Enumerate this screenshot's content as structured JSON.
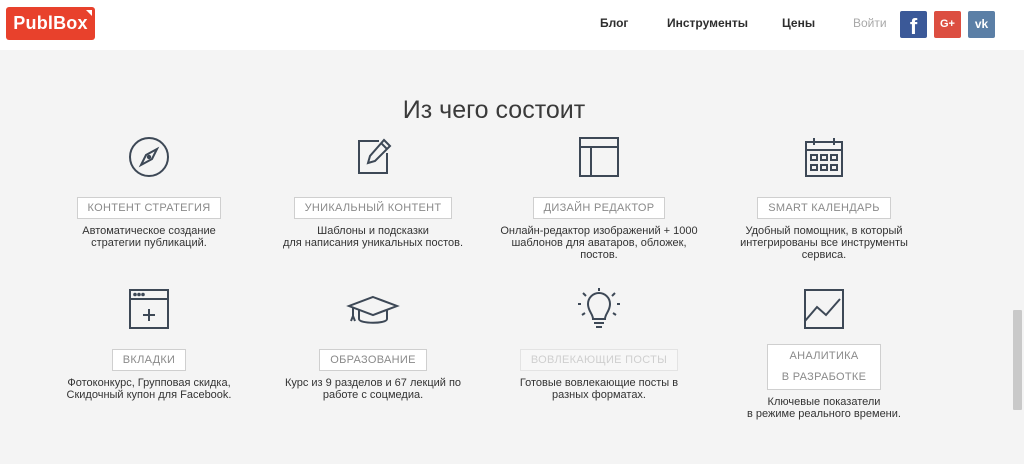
{
  "header": {
    "logo": "PublBox",
    "nav": [
      "Блог",
      "Инструменты",
      "Цены"
    ],
    "login": "Войти",
    "social": [
      {
        "name": "facebook",
        "label": "f",
        "color": "#3b5998"
      },
      {
        "name": "google-plus",
        "label": "G+",
        "color": "#dc4e41"
      },
      {
        "name": "vk",
        "label": "vk",
        "color": "#5b7fa6"
      }
    ]
  },
  "section": {
    "title": "Из чего состоит",
    "features": [
      {
        "icon": "compass-icon",
        "badge": "КОНТЕНТ СТРАТЕГИЯ",
        "desc": [
          "Автоматическое создание",
          "стратегии публикаций."
        ]
      },
      {
        "icon": "edit-icon",
        "badge": "УНИКАЛЬНЫЙ КОНТЕНТ",
        "desc": [
          "Шаблоны и подсказки",
          "для написания уникальных постов."
        ]
      },
      {
        "icon": "layout-icon",
        "badge": "ДИЗАЙН РЕДАКТОР",
        "desc": [
          "Онлайн-редактор изображений + 1000",
          "шаблонов для аватаров, обложек,",
          "постов."
        ]
      },
      {
        "icon": "calendar-icon",
        "badge": "SMART КАЛЕНДАРЬ",
        "desc": [
          "Удобный помощник, в который",
          "интегрированы все инструменты",
          "сервиса."
        ]
      },
      {
        "icon": "browser-add-icon",
        "badge": "ВКЛАДКИ",
        "desc": [
          "Фотоконкурс, Групповая скидка,",
          "Скидочный купон для Facebook."
        ]
      },
      {
        "icon": "graduation-cap-icon",
        "badge": "ОБРАЗОВАНИЕ",
        "desc": [
          "Курс из 9 разделов и 67 лекций по",
          "работе с соцмедиа."
        ]
      },
      {
        "icon": "lightbulb-icon",
        "badge": "ВОВЛЕКАЮЩИЕ ПОСТЫ",
        "desc": [
          "Готовые вовлекающие посты в",
          "разных форматах."
        ]
      },
      {
        "icon": "line-chart-icon",
        "badge": [
          "АНАЛИТИКА",
          "В РАЗРАБОТКЕ"
        ],
        "desc": [
          "Ключевые показатели",
          "в режиме реального времени."
        ]
      }
    ]
  },
  "colors": {
    "brand": "#e8412c",
    "icon_stroke": "#3d4856",
    "text": "#333333"
  }
}
